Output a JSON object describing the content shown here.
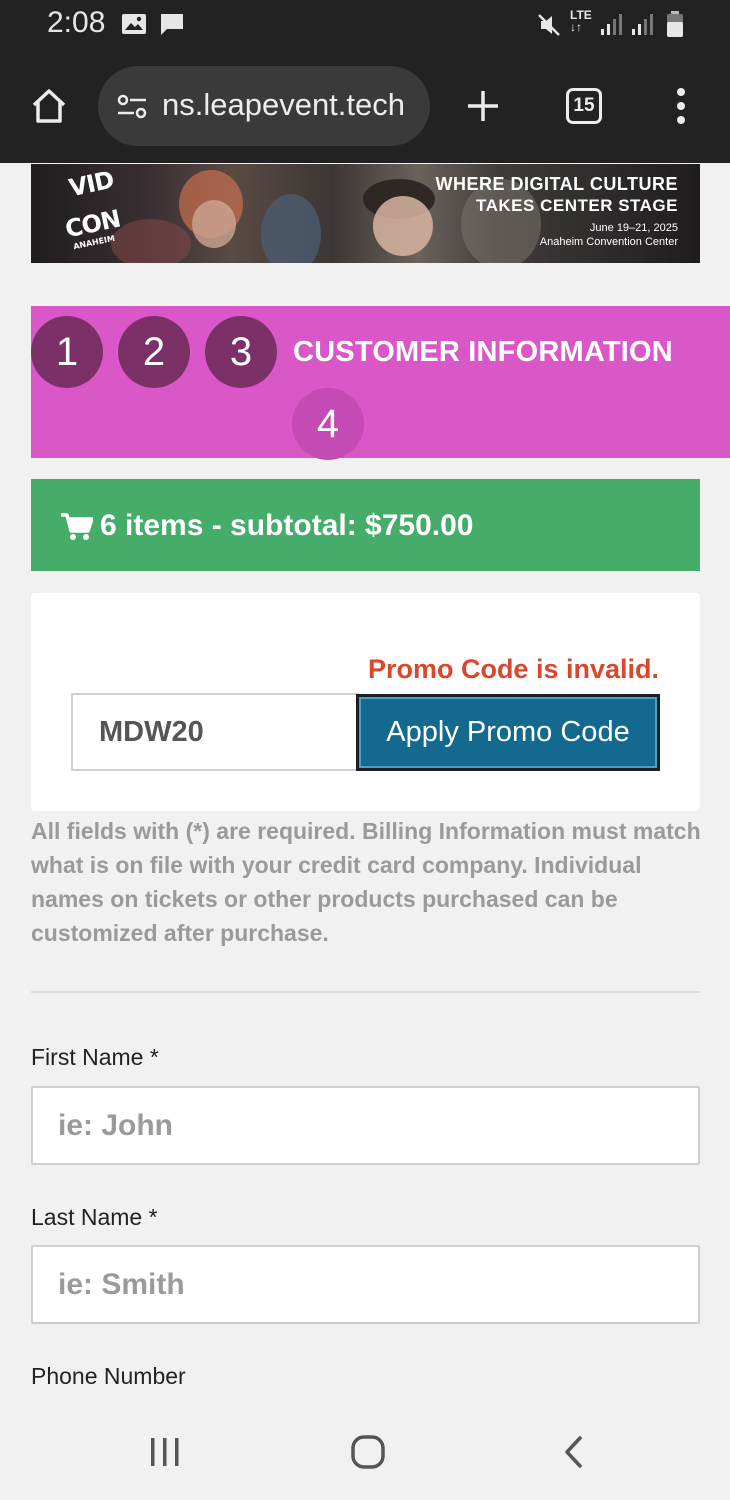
{
  "status_bar": {
    "time": "2:08",
    "icons": [
      "image-icon",
      "message-icon",
      "mute-icon",
      "lte-icon",
      "signal-icon",
      "signal-icon",
      "battery-icon"
    ],
    "network_label": "LTE"
  },
  "browser": {
    "url": "ns.leapevent.tech",
    "tab_count": "15",
    "icons": [
      "home-icon",
      "site-settings-icon",
      "new-tab-icon",
      "tabs-icon",
      "menu-icon"
    ]
  },
  "banner": {
    "logo_line1": "VID",
    "logo_line2": "CON",
    "logo_line3": "ANAHEIM",
    "headline1": "WHERE DIGITAL CULTURE",
    "headline2": "TAKES CENTER STAGE",
    "dates": "June 19–21, 2025",
    "venue": "Anaheim Convention Center"
  },
  "steps": {
    "items": [
      "1",
      "2",
      "3",
      "4"
    ],
    "current_title": "CUSTOMER INFORMATION"
  },
  "cart": {
    "summary": "6 items - subtotal: $750.00",
    "icon": "cart-icon"
  },
  "promo": {
    "error": "Promo Code is invalid.",
    "value": "MDW20",
    "button_label": "Apply Promo Code"
  },
  "info_text": "All fields with (*) are required. Billing Information must match what is on file with your credit card company. Individual names on tickets or other products purchased can be customized after purchase.",
  "form": {
    "first_name_label": "First Name *",
    "first_name_placeholder": "ie: John",
    "last_name_label": "Last Name *",
    "last_name_placeholder": "ie: Smith",
    "phone_label": "Phone Number"
  },
  "nav_bar": {
    "icons": [
      "recents-icon",
      "home-button-icon",
      "back-icon"
    ]
  },
  "colors": {
    "steps_bg": "#d957c6",
    "step_circle": "#7b3168",
    "cart_bg": "#45ad69",
    "error": "#d9482b",
    "button_bg": "#146a8e"
  }
}
